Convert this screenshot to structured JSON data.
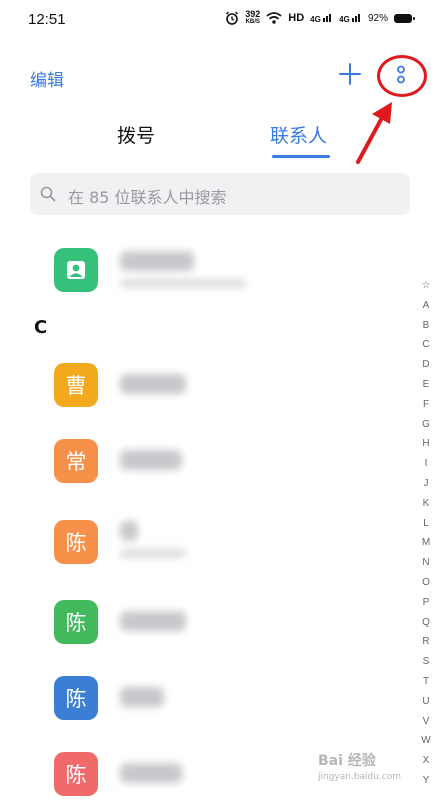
{
  "status_bar": {
    "time": "12:51",
    "speed_value": "392",
    "speed_unit": "KB/S",
    "hd_label": "HD",
    "net1": "4G",
    "net2": "4G",
    "battery_percent": "92%"
  },
  "toolbar": {
    "edit_label": "编辑",
    "accent_color": "#3a7be0"
  },
  "tabs": [
    {
      "label": "拨号",
      "active": false
    },
    {
      "label": "联系人",
      "active": true
    }
  ],
  "search": {
    "placeholder": "在 85 位联系人中搜索"
  },
  "contacts": {
    "section_letter": "C",
    "items": [
      {
        "avatar_char": "",
        "avatar_icon": "person-icon",
        "color": "#35c17a"
      },
      {
        "avatar_char": "曹",
        "color": "#f2a91d"
      },
      {
        "avatar_char": "常",
        "color": "#f7914a"
      },
      {
        "avatar_char": "陈",
        "color": "#f7914a"
      },
      {
        "avatar_char": "陈",
        "color": "#43b95d"
      },
      {
        "avatar_char": "陈",
        "color": "#3a7fd4"
      },
      {
        "avatar_char": "陈",
        "color": "#f06a6a"
      }
    ]
  },
  "alpha_index": [
    "☆",
    "A",
    "B",
    "C",
    "D",
    "E",
    "F",
    "G",
    "H",
    "I",
    "J",
    "K",
    "L",
    "M",
    "N",
    "O",
    "P",
    "Q",
    "R",
    "S",
    "T",
    "U",
    "V",
    "W",
    "X",
    "Y"
  ],
  "watermark": {
    "brand": "Bai 经验",
    "site": "jingyan.baidu.com"
  }
}
